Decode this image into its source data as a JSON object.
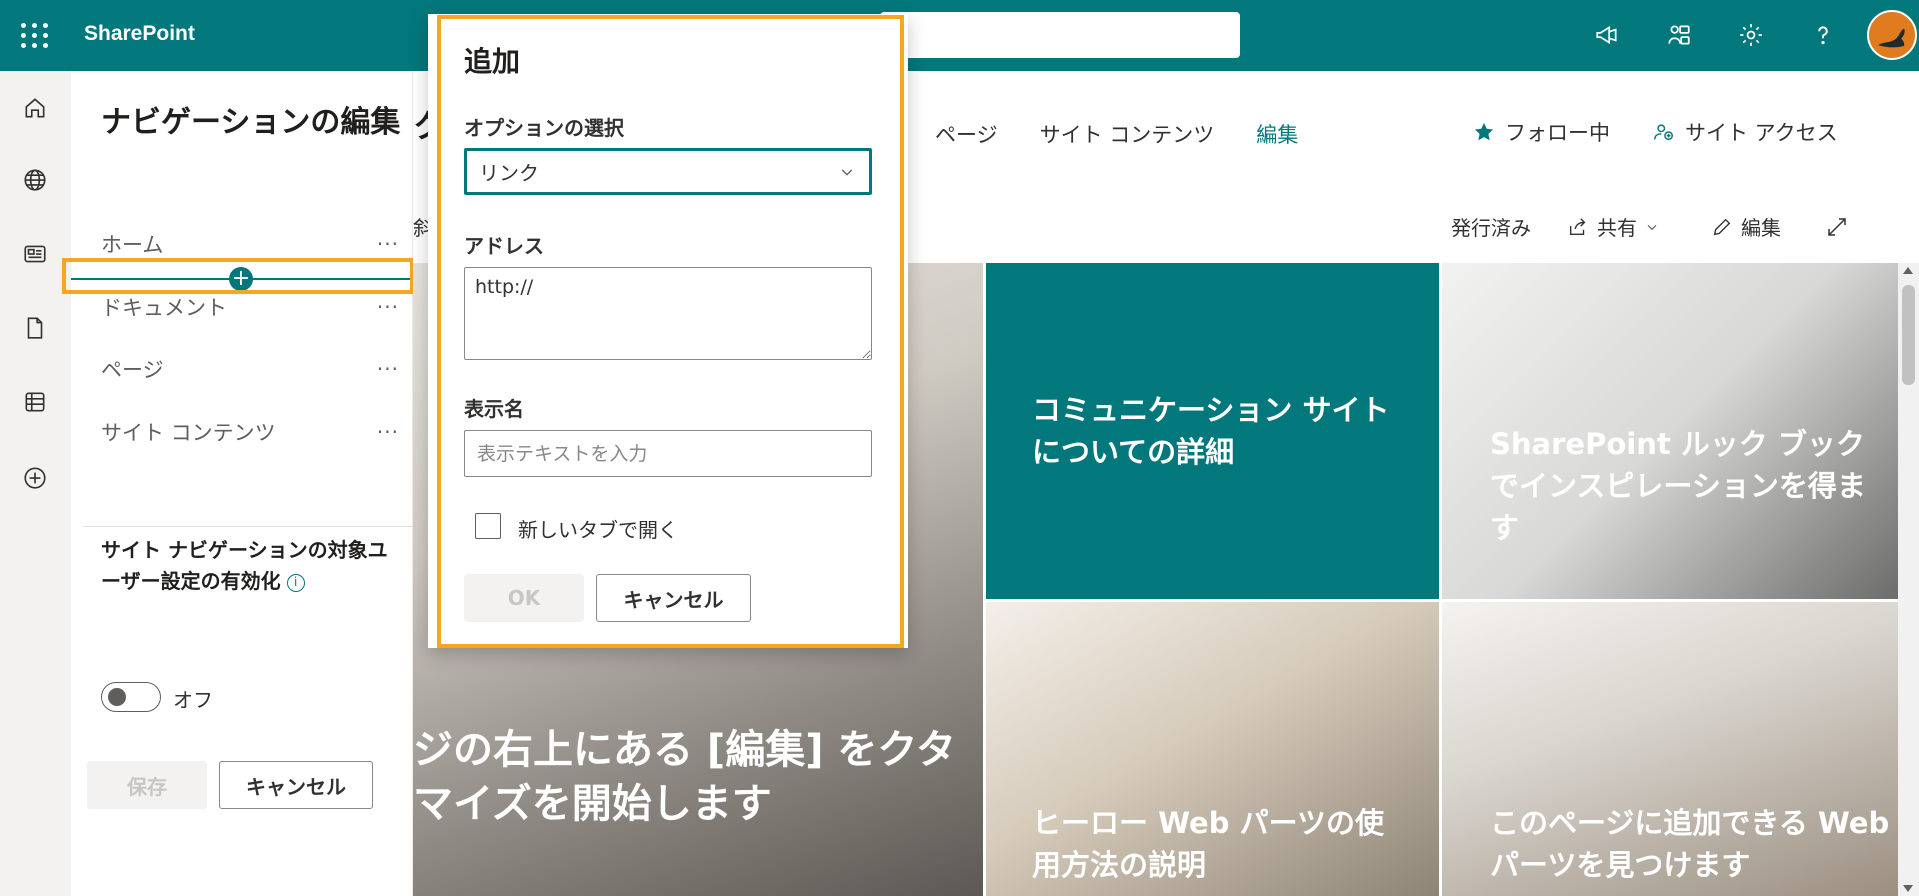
{
  "suite": {
    "app_name": "SharePoint",
    "icons": [
      "megaphone-icon",
      "people-connect-icon",
      "settings-gear-icon",
      "help-question-icon"
    ],
    "brand_color": "#03787c"
  },
  "appbar": {
    "icons": [
      "home-icon",
      "globe-icon",
      "news-icon",
      "document-icon",
      "list-icon",
      "add-circle-icon"
    ]
  },
  "navpanel": {
    "title": "ナビゲーションの編集",
    "items": [
      {
        "label": "ホーム",
        "more": "···"
      },
      {
        "label": "ドキュメント",
        "more": "···"
      },
      {
        "label": "ページ",
        "more": "···"
      },
      {
        "label": "サイト コンテンツ",
        "more": "···"
      }
    ],
    "audience_title": "サイト ナビゲーションの対象ユーザー設定の有効化",
    "info": "i",
    "toggle_label": "オフ",
    "save": "保存",
    "cancel": "キャンセル"
  },
  "site": {
    "title_fragment": "ク",
    "nav": [
      "ページ",
      "サイト コンテンツ",
      "編集"
    ],
    "follow": "フォロー中",
    "site_access": "サイト アクセス",
    "cmd_fragment": "斜",
    "published": "発行済み",
    "share": "共有",
    "edit": "編集",
    "tiles": {
      "main": "ジの右上にある [編集] をクタマイズを開始します",
      "teal": "コミュニケーション サイトについての詳細",
      "lookbook": "SharePoint ルック ブックでインスピレーションを得ます",
      "hero": "ヒーロー Web パーツの使用方法の説明",
      "add": "このページに追加できる Web パーツを見つけます"
    }
  },
  "dialog": {
    "title": "追加",
    "option_label": "オプションの選択",
    "option_value": "リンク",
    "address_label": "アドレス",
    "address_value": "http://",
    "display_label": "表示名",
    "display_placeholder": "表示テキストを入力",
    "new_tab": "新しいタブで開く",
    "ok": "OK",
    "cancel": "キャンセル"
  }
}
